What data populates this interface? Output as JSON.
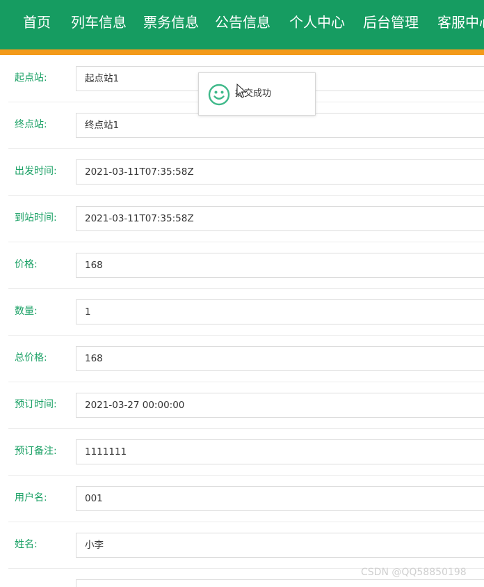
{
  "nav": {
    "items": [
      "首页",
      "列车信息",
      "票务信息",
      "公告信息",
      "个人中心",
      "后台管理",
      "客服中心"
    ]
  },
  "form": {
    "fields": [
      {
        "label": "起点站:",
        "value": "起点站1"
      },
      {
        "label": "终点站:",
        "value": "终点站1"
      },
      {
        "label": "出发时间:",
        "value": "2021-03-11T07:35:58Z"
      },
      {
        "label": "到站时间:",
        "value": "2021-03-11T07:35:58Z"
      },
      {
        "label": "价格:",
        "value": "168"
      },
      {
        "label": "数量:",
        "value": "1"
      },
      {
        "label": "总价格:",
        "value": "168"
      },
      {
        "label": "预订时间:",
        "value": "2021-03-27 00:00:00"
      },
      {
        "label": "预订备注:",
        "value": "1111111"
      },
      {
        "label": "用户名:",
        "value": "001"
      },
      {
        "label": "姓名:",
        "value": "小李"
      },
      {
        "label": "",
        "value": ""
      }
    ]
  },
  "toast": {
    "message": "提交成功",
    "icon": "smile-icon"
  },
  "watermark": "CSDN @QQ58850198",
  "colors": {
    "nav_bg": "#169c61",
    "nav_accent": "#f39a1a",
    "label": "#19a064",
    "toast_icon": "#3fb98a"
  }
}
